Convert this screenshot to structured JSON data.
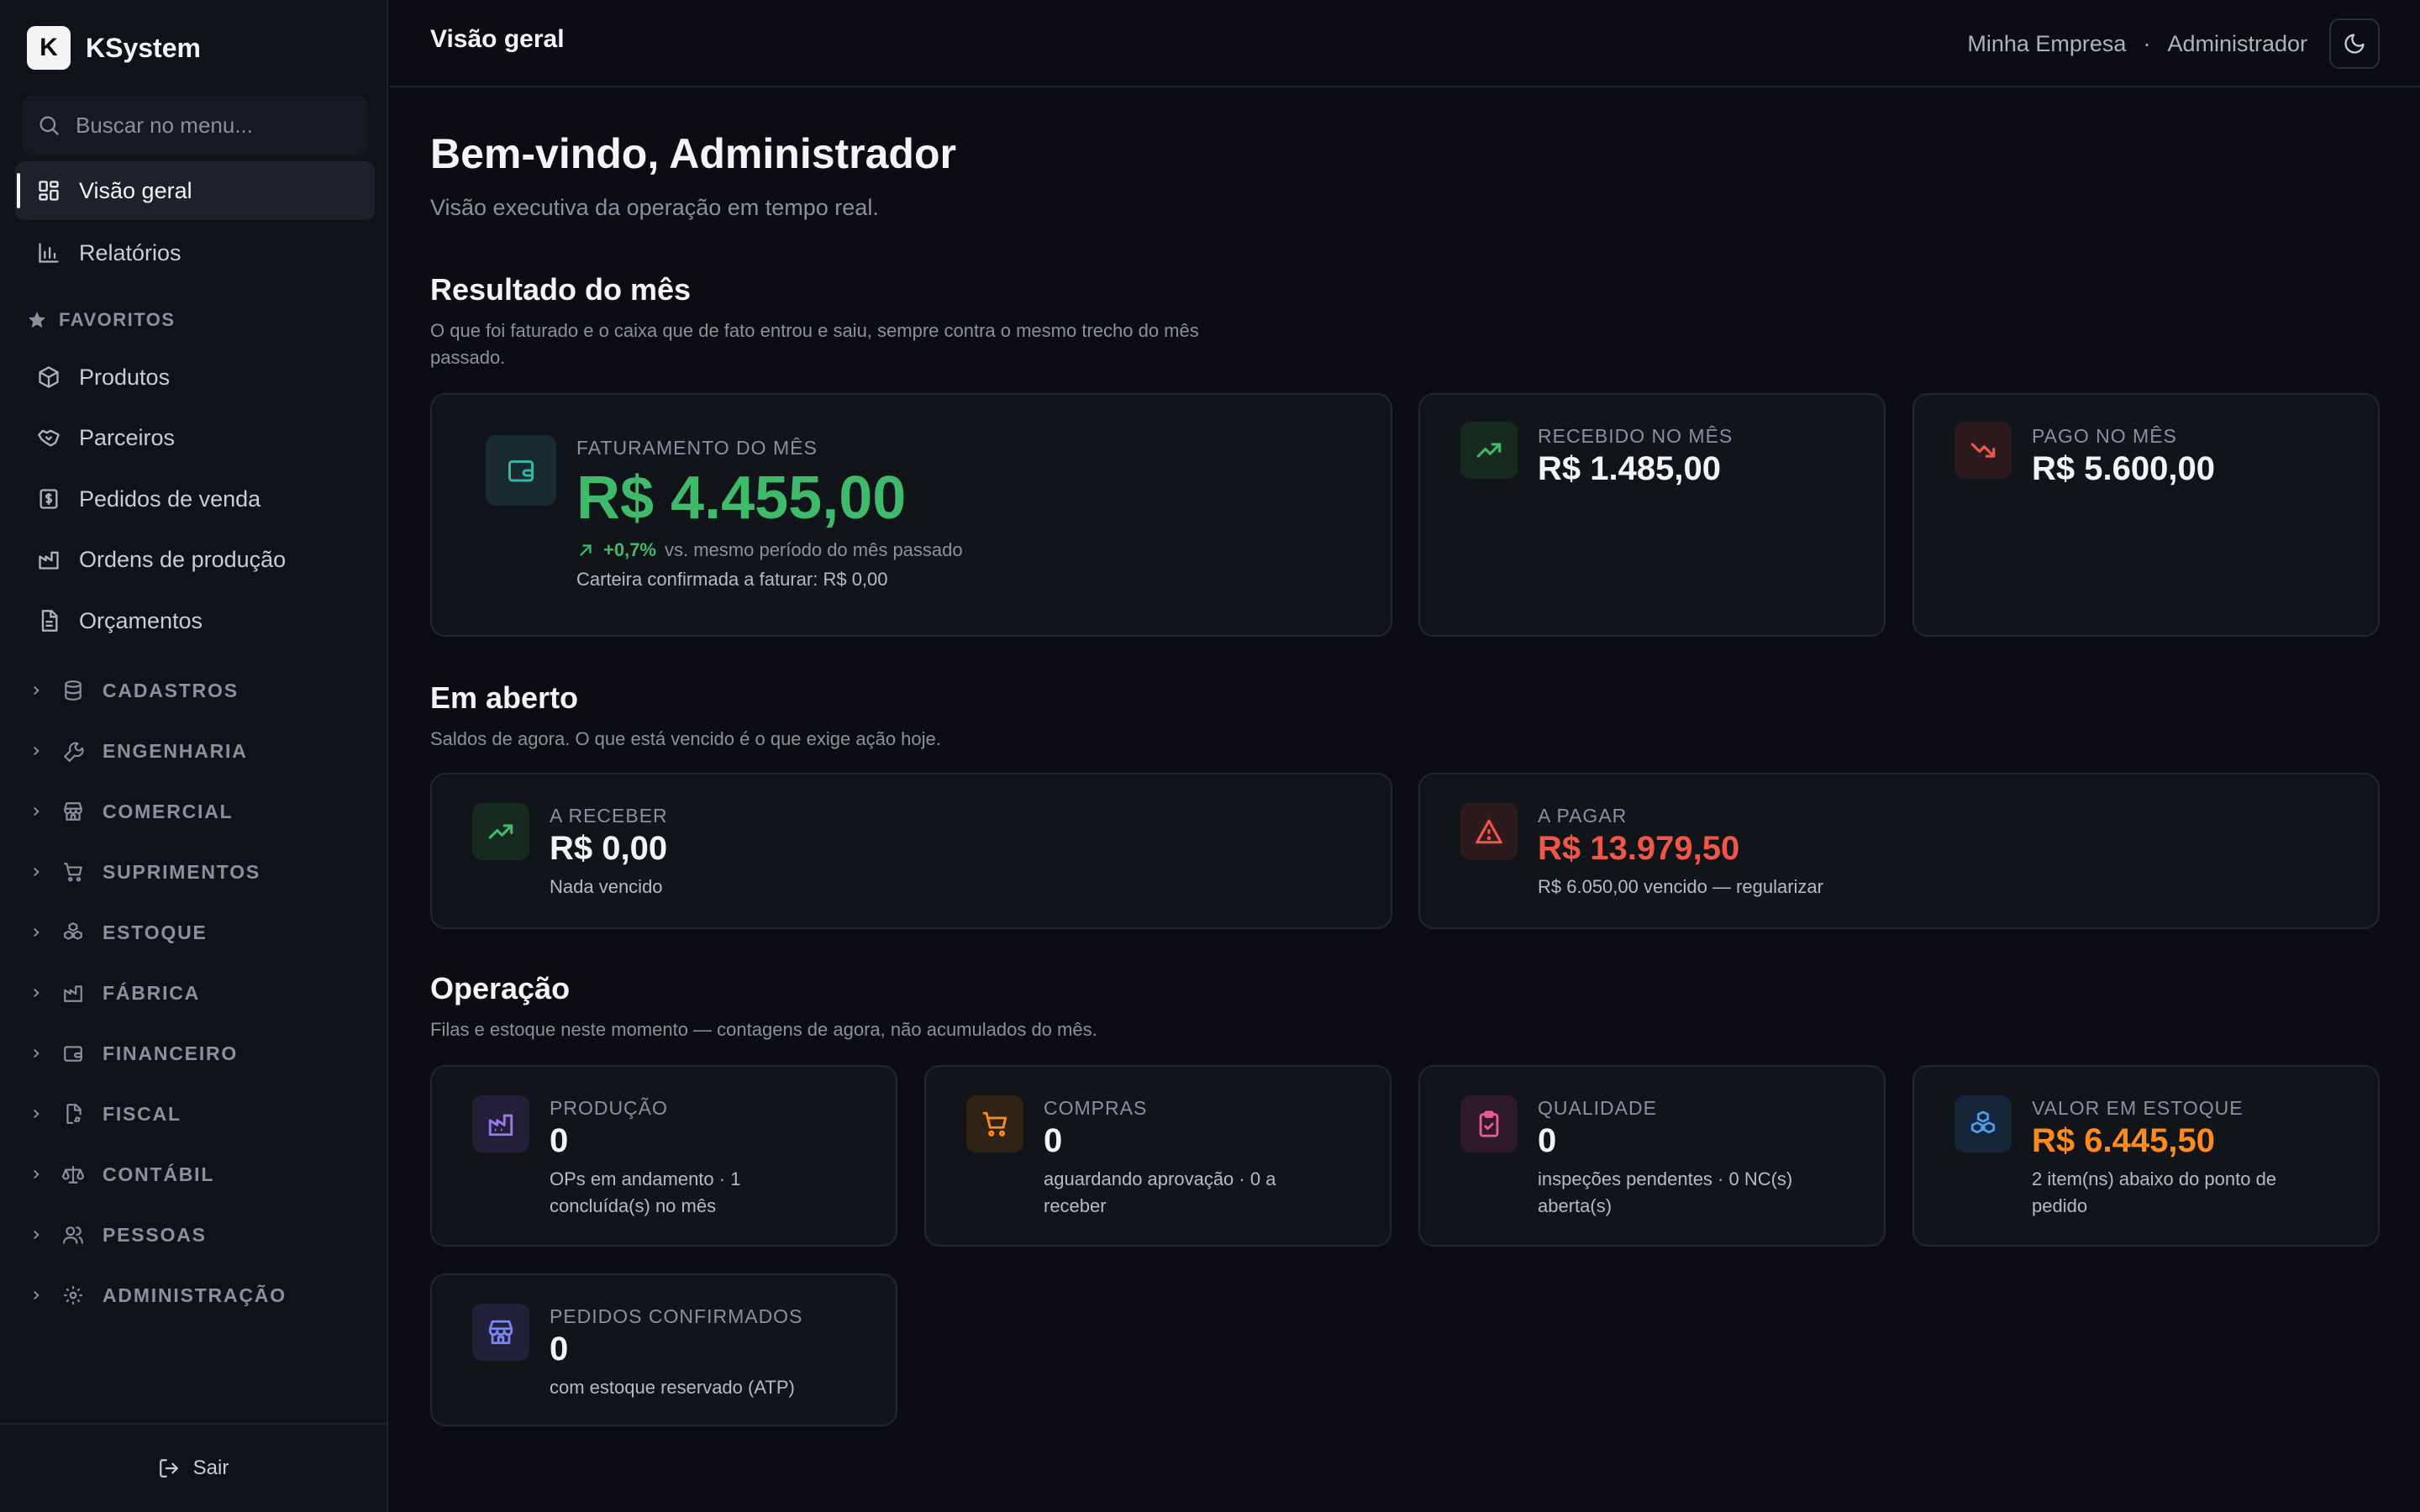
{
  "app": {
    "logo_letter": "K",
    "name": "KSystem"
  },
  "search": {
    "placeholder": "Buscar no menu..."
  },
  "nav": {
    "primary": [
      {
        "label": "Visão geral",
        "icon": "dashboard-icon",
        "active": true
      },
      {
        "label": "Relatórios",
        "icon": "bar-chart-icon"
      }
    ],
    "favorites_header": "FAVORITOS",
    "favorites": [
      {
        "label": "Produtos",
        "icon": "package-icon"
      },
      {
        "label": "Parceiros",
        "icon": "handshake-icon"
      },
      {
        "label": "Pedidos de venda",
        "icon": "receipt-icon"
      },
      {
        "label": "Ordens de produção",
        "icon": "factory-icon"
      },
      {
        "label": "Orçamentos",
        "icon": "document-icon"
      }
    ],
    "groups": [
      {
        "label": "CADASTROS",
        "icon": "database-icon"
      },
      {
        "label": "ENGENHARIA",
        "icon": "wrench-icon"
      },
      {
        "label": "COMERCIAL",
        "icon": "store-icon"
      },
      {
        "label": "SUPRIMENTOS",
        "icon": "cart-icon"
      },
      {
        "label": "ESTOQUE",
        "icon": "boxes-icon"
      },
      {
        "label": "FÁBRICA",
        "icon": "factory-icon"
      },
      {
        "label": "FINANCEIRO",
        "icon": "wallet-icon"
      },
      {
        "label": "FISCAL",
        "icon": "file-signature-icon"
      },
      {
        "label": "CONTÁBIL",
        "icon": "scale-icon"
      },
      {
        "label": "PESSOAS",
        "icon": "users-icon"
      },
      {
        "label": "ADMINISTRAÇÃO",
        "icon": "gear-icon"
      }
    ],
    "logout_label": "Sair"
  },
  "topbar": {
    "title": "Visão geral",
    "company": "Minha Empresa",
    "separator": "·",
    "user": "Administrador"
  },
  "welcome": {
    "title": "Bem-vindo, Administrador",
    "subtitle": "Visão executiva da operação em tempo real."
  },
  "sections": {
    "month": {
      "title": "Resultado do mês",
      "desc": "O que foi faturado e o caixa que de fato entrou e saiu, sempre contra o mesmo trecho do mês passado.",
      "billing": {
        "label": "FATURAMENTO DO MÊS",
        "value": "R$ 4.455,00",
        "delta": "+0,7%",
        "delta_text": "vs. mesmo período do mês passado",
        "note": "Carteira confirmada a faturar: R$ 0,00"
      },
      "received": {
        "label": "RECEBIDO NO MÊS",
        "value": "R$ 1.485,00"
      },
      "paid": {
        "label": "PAGO NO MÊS",
        "value": "R$ 5.600,00"
      }
    },
    "open": {
      "title": "Em aberto",
      "desc": "Saldos de agora. O que está vencido é o que exige ação hoje.",
      "receivable": {
        "label": "A RECEBER",
        "value": "R$ 0,00",
        "note": "Nada vencido"
      },
      "payable": {
        "label": "A PAGAR",
        "value": "R$ 13.979,50",
        "note": "R$ 6.050,00 vencido — regularizar"
      }
    },
    "operation": {
      "title": "Operação",
      "desc": "Filas e estoque neste momento — contagens de agora, não acumulados do mês.",
      "production": {
        "label": "PRODUÇÃO",
        "value": "0",
        "note": "OPs em andamento · 1 concluída(s) no mês"
      },
      "purchases": {
        "label": "COMPRAS",
        "value": "0",
        "note": "aguardando aprovação · 0 a receber"
      },
      "quality": {
        "label": "QUALIDADE",
        "value": "0",
        "note": "inspeções pendentes · 0 NC(s) aberta(s)"
      },
      "stock": {
        "label": "VALOR EM ESTOQUE",
        "value": "R$ 6.445,50",
        "note": "2 item(ns) abaixo do ponto de pedido"
      },
      "orders": {
        "label": "PEDIDOS CONFIRMADOS",
        "value": "0",
        "note": "com estoque reservado (ATP)"
      }
    }
  },
  "colors": {
    "positive": "#3fb96a",
    "negative": "#f0564a",
    "warning": "#ff8a1e",
    "background": "#0b0d11"
  }
}
